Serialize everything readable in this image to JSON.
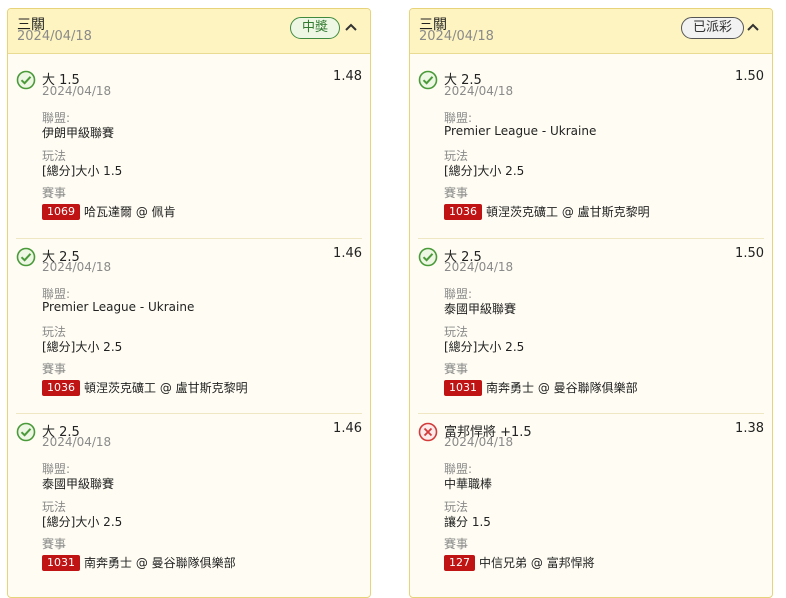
{
  "slips": [
    {
      "title": "三關",
      "date": "2024/04/18",
      "status": "中獎",
      "status_type": "win",
      "legs": [
        {
          "result": "won",
          "selection": "大 1.5",
          "odds": "1.48",
          "date": "2024/04/18",
          "league_label": "聯盟:",
          "league": "伊朗甲級聯賽",
          "market_label": "玩法",
          "market": "[總分]大小 1.5",
          "event_label": "賽事",
          "event_code": "1069",
          "event": "哈瓦達爾 @ 佩肯"
        },
        {
          "result": "won",
          "selection": "大 2.5",
          "odds": "1.46",
          "date": "2024/04/18",
          "league_label": "聯盟:",
          "league": "Premier League - Ukraine",
          "market_label": "玩法",
          "market": "[總分]大小 2.5",
          "event_label": "賽事",
          "event_code": "1036",
          "event": "頓涅茨克礦工 @ 盧甘斯克黎明"
        },
        {
          "result": "won",
          "selection": "大 2.5",
          "odds": "1.46",
          "date": "2024/04/18",
          "league_label": "聯盟:",
          "league": "泰國甲級聯賽",
          "market_label": "玩法",
          "market": "[總分]大小 2.5",
          "event_label": "賽事",
          "event_code": "1031",
          "event": "南奔勇士 @ 曼谷聯隊俱樂部"
        }
      ]
    },
    {
      "title": "三關",
      "date": "2024/04/18",
      "status": "已派彩",
      "status_type": "paid",
      "legs": [
        {
          "result": "won",
          "selection": "大 2.5",
          "odds": "1.50",
          "date": "2024/04/18",
          "league_label": "聯盟:",
          "league": "Premier League - Ukraine",
          "market_label": "玩法",
          "market": "[總分]大小 2.5",
          "event_label": "賽事",
          "event_code": "1036",
          "event": "頓涅茨克礦工 @ 盧甘斯克黎明"
        },
        {
          "result": "won",
          "selection": "大 2.5",
          "odds": "1.50",
          "date": "2024/04/18",
          "league_label": "聯盟:",
          "league": "泰國甲級聯賽",
          "market_label": "玩法",
          "market": "[總分]大小 2.5",
          "event_label": "賽事",
          "event_code": "1031",
          "event": "南奔勇士 @ 曼谷聯隊俱樂部"
        },
        {
          "result": "lost",
          "selection": "富邦悍將 +1.5",
          "odds": "1.38",
          "date": "2024/04/18",
          "league_label": "聯盟:",
          "league": "中華職棒",
          "market_label": "玩法",
          "market": "讓分 1.5",
          "event_label": "賽事",
          "event_code": "127",
          "event": "中信兄弟 @ 富邦悍將"
        }
      ]
    }
  ],
  "icons": {
    "won": "check-circle-icon",
    "lost": "x-circle-icon",
    "collapse": "chevron-up-icon"
  },
  "colors": {
    "won": "#4a9a3a",
    "lost": "#d33a3a",
    "code_bg": "#c01414",
    "header_bg": "#fdf4c1",
    "border": "#e7d37a"
  }
}
